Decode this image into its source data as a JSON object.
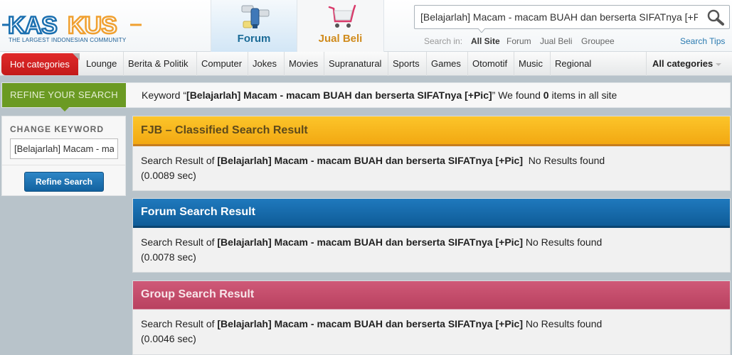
{
  "header": {
    "logo_text": "KASKUS",
    "logo_tagline": "THE LARGEST INDONESIAN COMMUNITY",
    "tabs": [
      {
        "label": "Forum",
        "icon": "forum-icon",
        "active": true
      },
      {
        "label": "Jual Beli",
        "icon": "shopping-cart-icon",
        "active": false
      }
    ],
    "search": {
      "value": "[Belajarlah] Macam - macam BUAH dan berserta SIFATnya [+Pic]",
      "search_in_label": "Search in:",
      "scopes": [
        "All Site",
        "Forum",
        "Jual Beli",
        "Groupee"
      ],
      "active_scope": "All Site",
      "tips_label": "Search Tips"
    }
  },
  "nav": {
    "hot_label": "Hot categories",
    "categories": [
      "Lounge",
      "Berita & Politik",
      "Computer",
      "Jokes",
      "Movies",
      "Supranatural",
      "Sports",
      "Games",
      "Otomotif",
      "Music",
      "Regional"
    ],
    "all_label": "All categories"
  },
  "refine": {
    "label": "REFINE YOUR SEARCH",
    "keyword_prefix": "Keyword “",
    "keyword": "[Belajarlah] Macam - macam BUAH dan berserta SIFATnya [+Pic]",
    "found_prefix": "” We found ",
    "count": "0",
    "found_suffix": " items in all site"
  },
  "sidebar": {
    "title": "CHANGE KEYWORD",
    "input_value": "[Belajarlah] Macam - macam BUAH dan berserta SIFATnya [+Pic]",
    "button_label": "Refine Search"
  },
  "results": [
    {
      "title": "FJB – Classified Search Result",
      "prefix": "Search Result of ",
      "keyword": "[Belajarlah] Macam - macam BUAH dan berserta SIFATnya [+Pic]",
      "status": "  No Results found",
      "time": "(0.0089 sec)",
      "color": "#f7b51b"
    },
    {
      "title": "Forum Search Result",
      "prefix": "Search Result of ",
      "keyword": "[Belajarlah] Macam - macam BUAH dan berserta SIFATnya [+Pic]",
      "status": " No Results found",
      "time": "(0.0078 sec)",
      "color": "#1566a8"
    },
    {
      "title": "Group Search Result",
      "prefix": "Search Result of ",
      "keyword": "[Belajarlah] Macam - macam BUAH dan berserta SIFATnya [+Pic]",
      "status": " No Results found",
      "time": "(0.0046 sec)",
      "color": "#c44d6c"
    }
  ]
}
